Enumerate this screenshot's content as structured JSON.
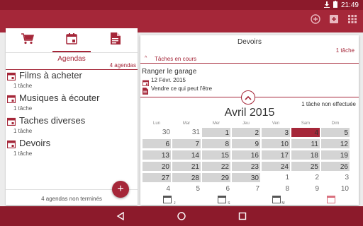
{
  "status_bar": {
    "time": "21:49",
    "icons": [
      "download-icon",
      "battery-icon"
    ]
  },
  "app_bar": {
    "color": "#a52739",
    "actions": [
      "add-circle-icon",
      "add-box-icon",
      "grid-icon"
    ]
  },
  "left_panel": {
    "tabs": [
      "cart-icon",
      "calendar-icon",
      "document-icon"
    ],
    "active_tab": "Agendas",
    "header_count": "4 agendas",
    "items": [
      {
        "name": "Films à acheter",
        "count": "1 tâche"
      },
      {
        "name": "Musiques à écouter",
        "count": "1 tâche"
      },
      {
        "name": "Taches diverses",
        "count": "1 tâche"
      },
      {
        "name": "Devoirs",
        "count": "1 tâche"
      }
    ],
    "footer": "4 agendas non terminés"
  },
  "right_panel": {
    "title": "Devoirs",
    "count": "1 tâche",
    "section": "Tâches en cours",
    "task": {
      "title": "Ranger le garage",
      "date": "12 Févr. 2015",
      "note": "Vendre ce qui peut l'être"
    },
    "undone": "1 tâche non effectuée",
    "calendar": {
      "month": "Avril 2015",
      "weekdays": [
        "Lun",
        "Mar",
        "Mer",
        "Jeu",
        "Ven",
        "Sam",
        "Dim"
      ],
      "weeks": [
        [
          "30",
          "31",
          "1",
          "2",
          "3",
          "4",
          "5"
        ],
        [
          "6",
          "7",
          "8",
          "9",
          "10",
          "11",
          "12"
        ],
        [
          "13",
          "14",
          "15",
          "16",
          "17",
          "18",
          "19"
        ],
        [
          "20",
          "21",
          "22",
          "23",
          "24",
          "25",
          "26"
        ],
        [
          "27",
          "28",
          "29",
          "30",
          "1",
          "2",
          "3"
        ],
        [
          "4",
          "5",
          "6",
          "7",
          "8",
          "9",
          "10"
        ]
      ],
      "today": "4",
      "bottom_tabs": [
        "J",
        "S",
        "M",
        ""
      ]
    }
  },
  "nav_bar": {
    "buttons": [
      "back-icon",
      "home-icon",
      "recents-icon"
    ]
  }
}
